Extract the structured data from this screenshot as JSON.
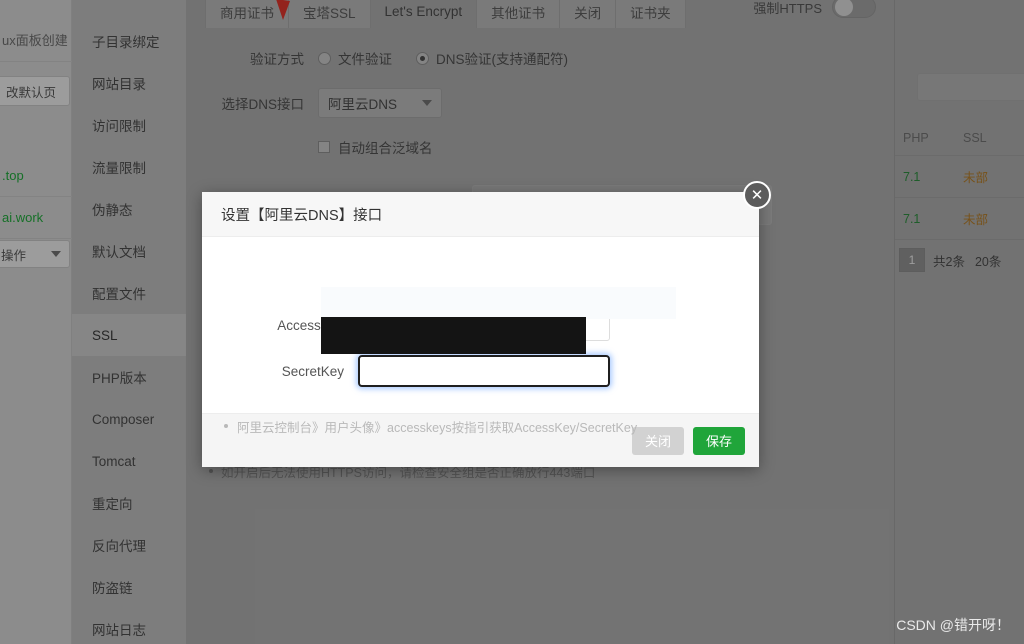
{
  "window": {
    "background_color": "#9d9d9d"
  },
  "left_strip": {
    "rows": [
      {
        "label": "ux面板创建"
      },
      {
        "label": "改默认页"
      },
      {
        "label": ".top"
      },
      {
        "label": "ai.work"
      },
      {
        "label": "操作"
      }
    ]
  },
  "sidebar": {
    "items": [
      {
        "label": "子目录绑定",
        "active": false
      },
      {
        "label": "网站目录",
        "active": false
      },
      {
        "label": "访问限制",
        "active": false
      },
      {
        "label": "流量限制",
        "active": false
      },
      {
        "label": "伪静态",
        "active": false
      },
      {
        "label": "默认文档",
        "active": false
      },
      {
        "label": "配置文件",
        "active": false
      },
      {
        "label": "SSL",
        "active": true
      },
      {
        "label": "PHP版本",
        "active": false
      },
      {
        "label": "Composer",
        "active": false
      },
      {
        "label": "Tomcat",
        "active": false
      },
      {
        "label": "重定向",
        "active": false
      },
      {
        "label": "反向代理",
        "active": false
      },
      {
        "label": "防盗链",
        "active": false
      },
      {
        "label": "网站日志",
        "active": false
      }
    ]
  },
  "tabs": [
    {
      "label": "商用证书",
      "active": false,
      "flag": true
    },
    {
      "label": "宝塔SSL",
      "active": false,
      "flag": false
    },
    {
      "label": "Let's Encrypt",
      "active": true,
      "flag": false
    },
    {
      "label": "其他证书",
      "active": false,
      "flag": false
    },
    {
      "label": "关闭",
      "active": false,
      "flag": false
    },
    {
      "label": "证书夹",
      "active": false,
      "flag": false
    }
  ],
  "force_https": {
    "label": "强制HTTPS",
    "enabled": false
  },
  "ssl_form": {
    "verify_method_label": "验证方式",
    "options": [
      {
        "label": "文件验证",
        "selected": false
      },
      {
        "label": "DNS验证(支持通配符)",
        "selected": true
      }
    ],
    "dns_interface_label": "选择DNS接口",
    "dns_interface_value": "阿里云DNS",
    "auto_wildcard_label": "自动组合泛域名",
    "auto_wildcard_checked": false,
    "note": "如开启后无法使用HTTPS访问，请检查安全组是否正确放行443端口"
  },
  "modal": {
    "title": "设置【阿里云DNS】接口",
    "close_icon": "close-icon",
    "fields": [
      {
        "name": "AccessKey",
        "label": "AccessKey",
        "value": "",
        "focused": false
      },
      {
        "name": "SecretKey",
        "label": "SecretKey",
        "value": "",
        "focused": true
      }
    ],
    "hint": "阿里云控制台》用户头像》accesskeys按指引获取AccessKey/SecretKey",
    "buttons": {
      "cancel_label": "关闭",
      "save_label": "保存",
      "save_color": "#20a53a",
      "cancel_color": "#d2d2d2"
    }
  },
  "right_table": {
    "headers": [
      "PHP",
      "SSL"
    ],
    "rows": [
      {
        "php": "7.1",
        "ssl": "未部"
      },
      {
        "php": "7.1",
        "ssl": "未部"
      }
    ],
    "pagination": {
      "page": "1",
      "total_label": "共2条",
      "per_page_label": "20条"
    }
  },
  "watermark": "CSDN @错开呀！"
}
